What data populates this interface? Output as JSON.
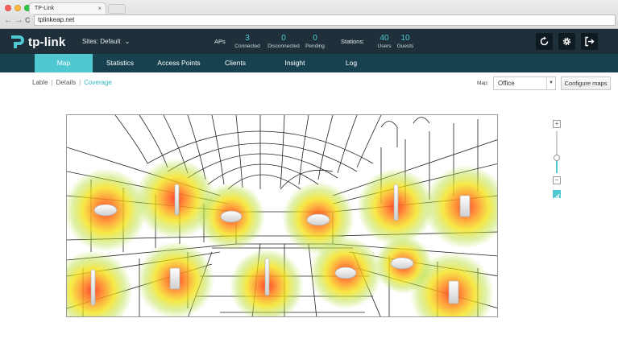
{
  "browser": {
    "tab_title": "TP-Link",
    "tab_close": "×",
    "url": "tplinkeap.net",
    "back": "←",
    "forward": "→",
    "reload": "C"
  },
  "header": {
    "brand": "tp-link",
    "sites_label": "Sites: Default",
    "sites_caret": "⌄",
    "aps_label": "APs",
    "aps": [
      {
        "value": "3",
        "label": "Connected"
      },
      {
        "value": "0",
        "label": "Disconnected"
      },
      {
        "value": "0",
        "label": "Pending"
      }
    ],
    "stations_label": "Stations:",
    "stations": [
      {
        "value": "40",
        "label": "Users"
      },
      {
        "value": "10",
        "label": "Guests"
      }
    ],
    "icons": [
      "refresh-icon",
      "gear-icon",
      "logout-icon"
    ]
  },
  "nav": {
    "tabs": [
      {
        "label": "Map",
        "active": true
      },
      {
        "label": "Statistics",
        "active": false
      },
      {
        "label": "Access Points",
        "active": false
      },
      {
        "label": "Clients",
        "active": false
      },
      {
        "label": "Insight",
        "active": false
      },
      {
        "label": "Log",
        "active": false
      }
    ]
  },
  "subnav": {
    "items": [
      "Lable",
      "Details",
      "Coverage"
    ],
    "active": "Coverage",
    "separator": "|"
  },
  "map_controls": {
    "map_label": "Map:",
    "map_value": "Office",
    "configure_label": "Configure maps",
    "zoom_in": "+",
    "zoom_out": "−",
    "zoom_level": 0.35
  },
  "colors": {
    "accent": "#4fc8d2",
    "header_bg": "#20303b",
    "nav_bg": "#17414f",
    "heat_core": "#ff3b1f",
    "heat_mid": "#f4e20a",
    "heat_outer": "#b8de3a"
  },
  "access_points": [
    {
      "type": "ceiling"
    },
    {
      "type": "antenna"
    },
    {
      "type": "ceiling"
    },
    {
      "type": "ceiling"
    },
    {
      "type": "antenna"
    },
    {
      "type": "wall"
    },
    {
      "type": "antenna"
    },
    {
      "type": "wall"
    },
    {
      "type": "antenna"
    },
    {
      "type": "ceiling"
    },
    {
      "type": "ceiling"
    },
    {
      "type": "wall"
    }
  ]
}
